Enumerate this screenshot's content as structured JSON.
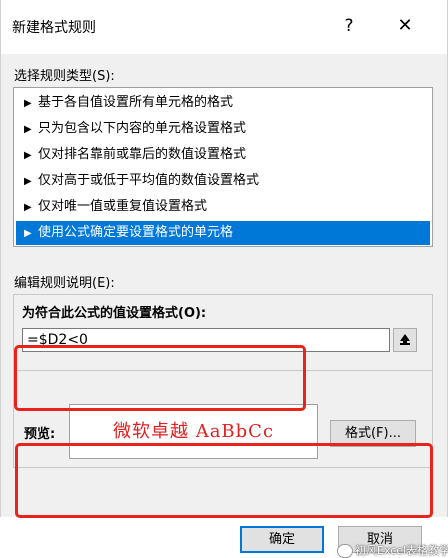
{
  "window": {
    "title": "新建格式规则",
    "help_glyph": "?",
    "close_glyph": "✕"
  },
  "rule_type": {
    "label": "选择规则类型(S):",
    "items": [
      {
        "label": "基于各自值设置所有单元格的格式"
      },
      {
        "label": "只为包含以下内容的单元格设置格式"
      },
      {
        "label": "仅对排名靠前或靠后的数值设置格式"
      },
      {
        "label": "仅对高于或低于平均值的数值设置格式"
      },
      {
        "label": "仅对唯一值或重复值设置格式"
      },
      {
        "label": "使用公式确定要设置格式的单元格"
      }
    ],
    "selected_index": 5,
    "item_marker": "▶"
  },
  "rule_desc": {
    "label": "编辑规则说明(E):",
    "formula_label": "为符合此公式的值设置格式(O):",
    "formula_value": "=$D2<0",
    "preview_label": "预览:",
    "preview_text": "微软卓越  AaBbCc",
    "format_button": "格式(F)..."
  },
  "buttons": {
    "ok": "确定",
    "cancel": "取消"
  },
  "watermark": "初风Excel表格教学",
  "colors": {
    "accent": "#0078d7",
    "highlight": "#e8231c",
    "preview_text": "#e02020"
  }
}
